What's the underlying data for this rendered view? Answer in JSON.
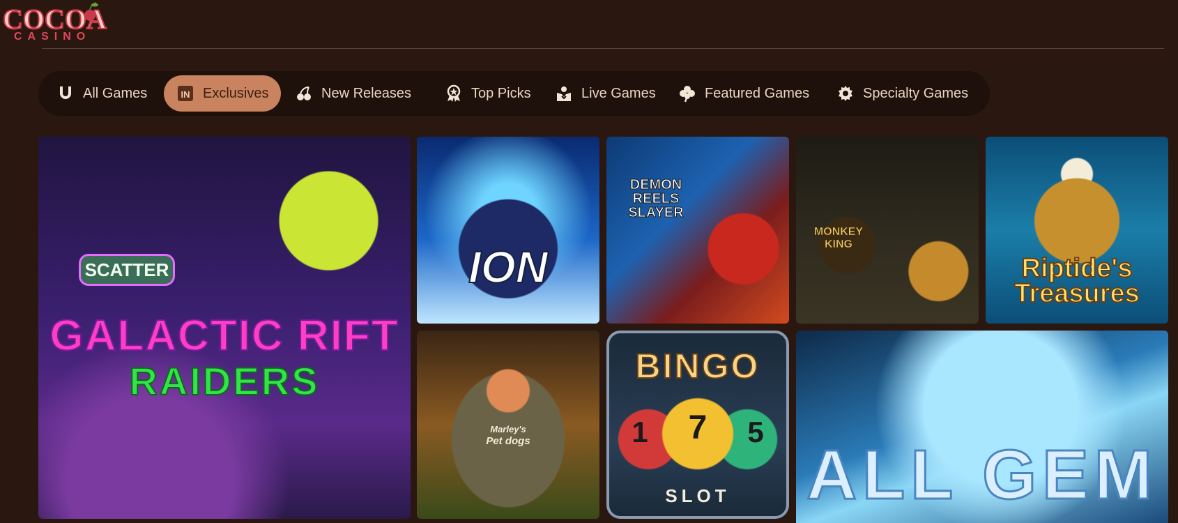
{
  "logo": {
    "word": "COCOA",
    "sub": "CASINO"
  },
  "tabs": [
    {
      "label": "All Games",
      "icon": "horseshoe-icon"
    },
    {
      "label": "Exclusives",
      "icon": "in-badge-icon"
    },
    {
      "label": "New Releases",
      "icon": "cherries-icon"
    },
    {
      "label": "Top Picks",
      "icon": "award-star-icon"
    },
    {
      "label": "Live Games",
      "icon": "dealer-icon"
    },
    {
      "label": "Featured Games",
      "icon": "clover-icon"
    },
    {
      "label": "Specialty Games",
      "icon": "gear-icon"
    }
  ],
  "active_tab": "Exclusives",
  "games": [
    {
      "title": "GALACTIC RIFT",
      "title2": "RAIDERS",
      "badge": "SCATTER"
    },
    {
      "title": "ION"
    },
    {
      "title": "DEMON",
      "title2": "REELS",
      "title3": "SLAYER"
    },
    {
      "title": "MONKEY",
      "title2": "KING"
    },
    {
      "title": "Riptide's",
      "title2": "Treasures"
    },
    {
      "title": "Marley's",
      "title2": "Pet dogs"
    },
    {
      "title": "BINGO",
      "balls": [
        "1",
        "7",
        "5"
      ],
      "title2": "SLOT"
    },
    {
      "title": "ALL GEM"
    }
  ],
  "colors": {
    "background": "#2a1710",
    "tabbar": "#1e100a",
    "active_tab": "#c9845f",
    "logo_red": "#c8394b"
  }
}
